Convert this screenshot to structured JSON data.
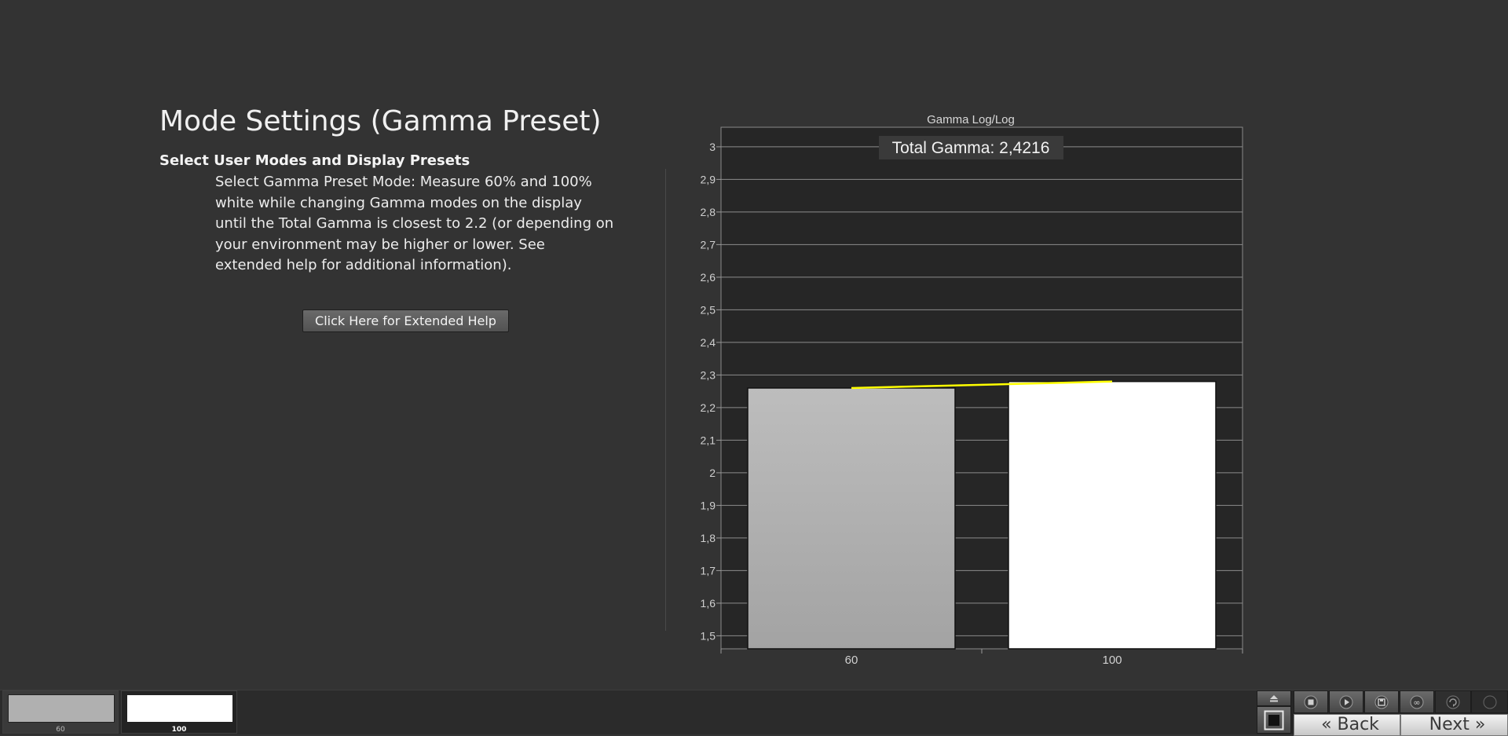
{
  "page": {
    "title": "Mode Settings (Gamma Preset)",
    "subtitle": "Select User Modes and Display Presets",
    "instructions": "Select Gamma Preset Mode: Measure 60% and 100% white while changing Gamma modes on the display until the Total Gamma is closest to 2.2 (or depending on your environment may be higher or lower. See extended help for additional information).",
    "help_button_label": "Click Here for Extended Help"
  },
  "chart_data": {
    "type": "bar",
    "title": "Gamma Log/Log",
    "annotation": "Total Gamma: 2,4216",
    "categories": [
      "60",
      "100"
    ],
    "values": [
      2.26,
      2.28
    ],
    "line_series": {
      "color": "#ffff00",
      "values": [
        2.26,
        2.28
      ]
    },
    "ylim": [
      1.46,
      3.06
    ],
    "yticks": [
      "3",
      "2,9",
      "2,8",
      "2,7",
      "2,6",
      "2,5",
      "2,4",
      "2,3",
      "2,2",
      "2,1",
      "2",
      "1,9",
      "1,8",
      "1,7",
      "1,6",
      "1,5"
    ],
    "bar_colors": [
      "#a3a3a3",
      "#ffffff"
    ],
    "grid": true,
    "xlabel": "",
    "ylabel": ""
  },
  "patches": [
    {
      "label": "60",
      "color": "#b0b0b0"
    },
    {
      "label": "100",
      "color": "#ffffff"
    }
  ],
  "toolbar": {
    "icons": [
      "eject-icon",
      "stop-icon",
      "play-icon",
      "save-icon",
      "loop-icon",
      "refresh-icon",
      "record-icon",
      "square-icon"
    ],
    "back_label": "« Back",
    "next_label": "Next »"
  }
}
